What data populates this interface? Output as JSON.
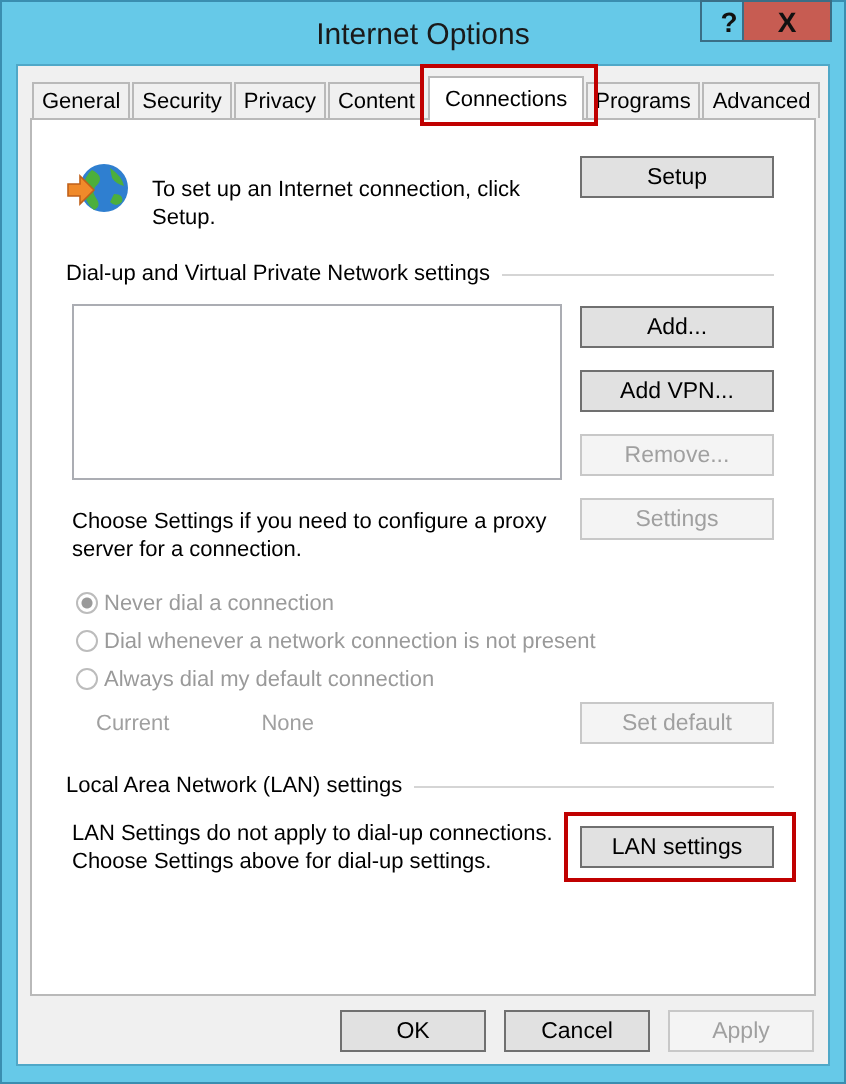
{
  "window": {
    "title": "Internet Options",
    "help_button": "?",
    "close_button": "X"
  },
  "tabs": [
    {
      "label": "General",
      "selected": false,
      "highlighted": false
    },
    {
      "label": "Security",
      "selected": false,
      "highlighted": false
    },
    {
      "label": "Privacy",
      "selected": false,
      "highlighted": false
    },
    {
      "label": "Content",
      "selected": false,
      "highlighted": false
    },
    {
      "label": "Connections",
      "selected": true,
      "highlighted": true
    },
    {
      "label": "Programs",
      "selected": false,
      "highlighted": false
    },
    {
      "label": "Advanced",
      "selected": false,
      "highlighted": false
    }
  ],
  "setup": {
    "text": "To set up an Internet connection, click Setup.",
    "button": {
      "label": "Setup",
      "disabled": false
    }
  },
  "dialup": {
    "heading": "Dial-up and Virtual Private Network settings",
    "buttons": [
      {
        "label": "Add...",
        "disabled": false
      },
      {
        "label": "Add VPN...",
        "disabled": false
      },
      {
        "label": "Remove...",
        "disabled": true
      },
      {
        "label": "Settings",
        "disabled": true
      }
    ],
    "proxy_text": "Choose Settings if you need to configure a proxy server for a connection.",
    "options": [
      {
        "label": "Never dial a connection",
        "selected": true,
        "disabled": true
      },
      {
        "label": "Dial whenever a network connection is not present",
        "selected": false,
        "disabled": true
      },
      {
        "label": "Always dial my default connection",
        "selected": false,
        "disabled": true
      }
    ],
    "current_label": "Current",
    "current_value": "None",
    "set_default": {
      "label": "Set default",
      "disabled": true
    }
  },
  "lan": {
    "heading": "Local Area Network (LAN) settings",
    "text": "LAN Settings do not apply to dial-up connections. Choose Settings above for dial-up settings.",
    "button": {
      "label": "LAN settings",
      "disabled": false,
      "highlighted": true
    }
  },
  "footer_buttons": [
    {
      "label": "OK",
      "disabled": false
    },
    {
      "label": "Cancel",
      "disabled": false
    },
    {
      "label": "Apply",
      "disabled": true
    }
  ]
}
